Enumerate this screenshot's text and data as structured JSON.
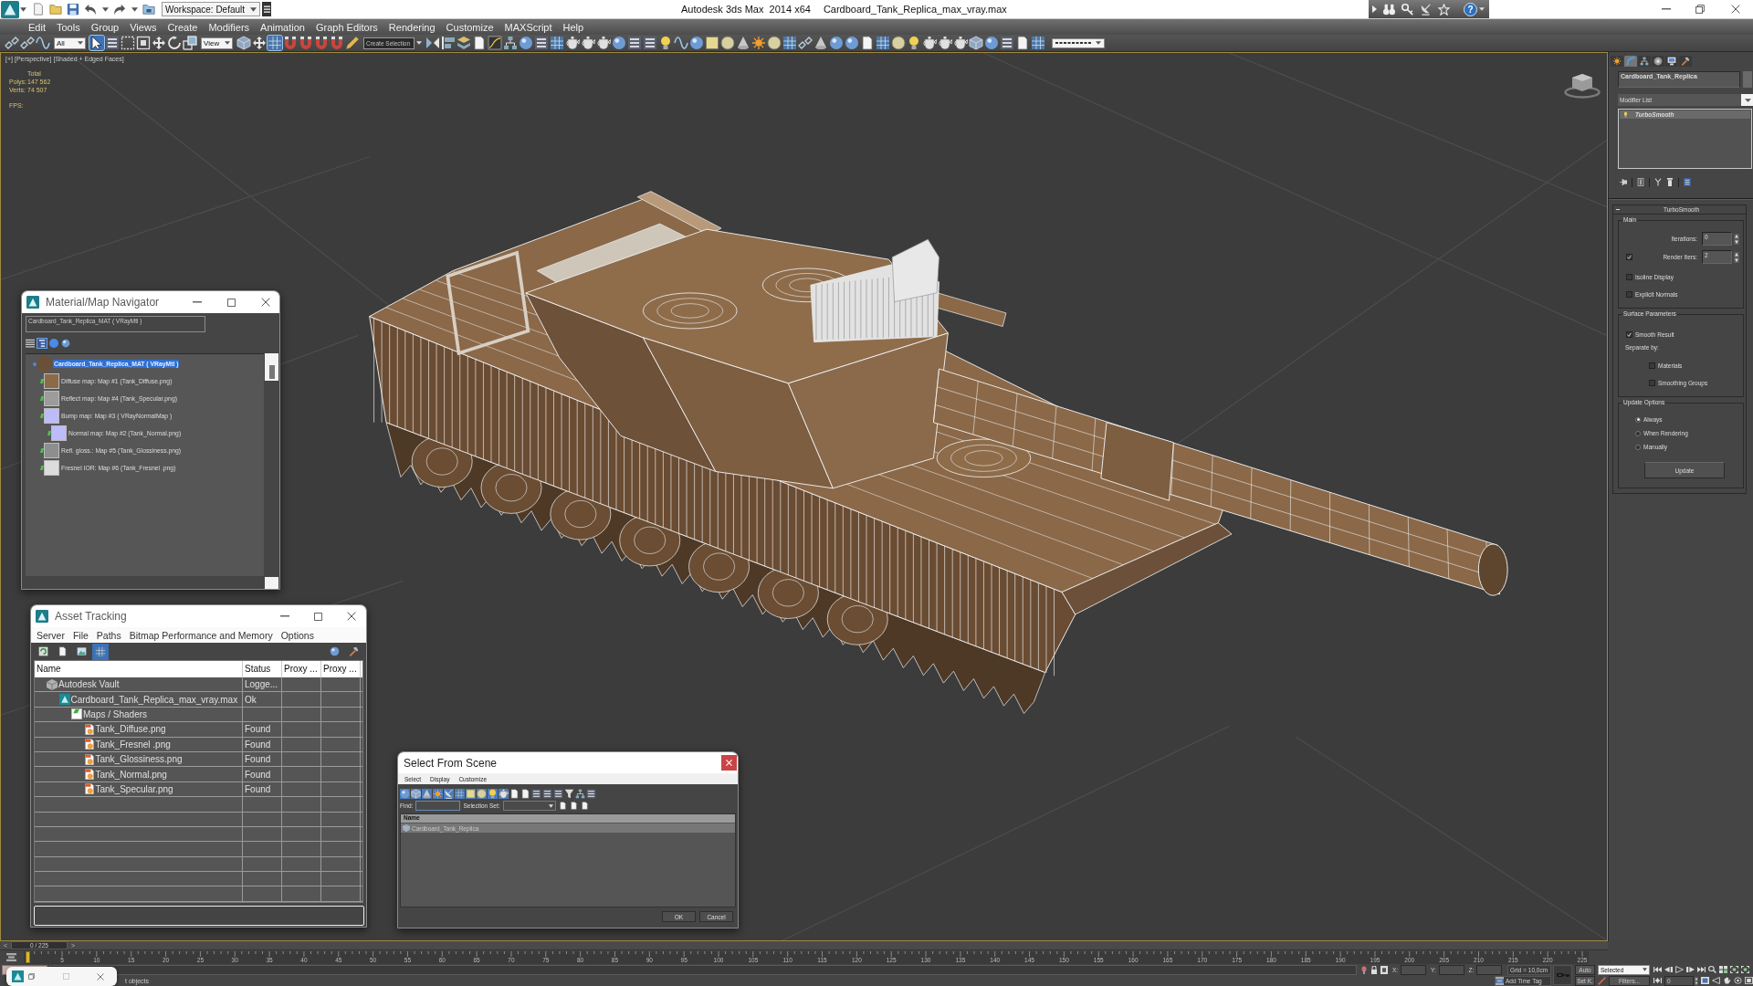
{
  "title_bar": {
    "workspace": "Workspace: Default",
    "app_name": "Autodesk 3ds Max  2014 x64",
    "document": "Cardboard_Tank_Replica_max_vray.max",
    "help": "?"
  },
  "menu_bar": [
    "Edit",
    "Tools",
    "Group",
    "Views",
    "Create",
    "Modifiers",
    "Animation",
    "Graph Editors",
    "Rendering",
    "Customize",
    "MAXScript",
    "Help"
  ],
  "main_toolbar": [
    {
      "kind": "button",
      "selected": false
    },
    {
      "kind": "button",
      "selected": false
    },
    {
      "kind": "button",
      "selected": false
    },
    {
      "kind": "dropdown",
      "value": "All"
    },
    {
      "kind": "button",
      "selected": true
    },
    {
      "kind": "button",
      "selected": false
    },
    {
      "kind": "button",
      "selected": false
    },
    {
      "kind": "button",
      "selected": false
    },
    {
      "kind": "button",
      "selected": false
    },
    {
      "kind": "button",
      "selected": false
    },
    {
      "kind": "button",
      "selected": false
    },
    {
      "kind": "dropdown",
      "value": "View"
    },
    {
      "kind": "button",
      "selected": false
    },
    {
      "kind": "button",
      "selected": false
    },
    {
      "kind": "button",
      "selected": true
    },
    {
      "kind": "button",
      "selected": false
    },
    {
      "kind": "button",
      "selected": false
    },
    {
      "kind": "button",
      "selected": false
    },
    {
      "kind": "button",
      "selected": false
    },
    {
      "kind": "button",
      "selected": false
    },
    {
      "kind": "combo",
      "placeholder": "Create Selection"
    },
    {
      "kind": "button",
      "selected": false
    },
    {
      "kind": "button",
      "selected": false
    },
    {
      "kind": "button",
      "selected": false
    },
    {
      "kind": "button",
      "selected": false
    },
    {
      "kind": "button",
      "selected": false
    },
    {
      "kind": "button",
      "selected": false
    },
    {
      "kind": "button",
      "selected": false
    },
    {
      "kind": "button",
      "selected": false
    },
    {
      "kind": "button",
      "selected": false
    },
    {
      "kind": "button",
      "selected": false
    },
    {
      "kind": "button",
      "selected": false
    },
    {
      "kind": "button",
      "selected": false
    },
    {
      "kind": "button",
      "selected": false
    },
    {
      "kind": "button",
      "selected": false
    },
    {
      "kind": "button",
      "selected": false
    },
    {
      "kind": "button",
      "selected": false
    },
    {
      "kind": "button",
      "selected": false
    },
    {
      "kind": "button",
      "selected": false
    },
    {
      "kind": "button",
      "selected": false
    },
    {
      "kind": "button",
      "selected": false
    },
    {
      "kind": "button",
      "selected": false
    },
    {
      "kind": "button",
      "selected": false
    },
    {
      "kind": "button",
      "selected": false
    },
    {
      "kind": "button",
      "selected": false
    },
    {
      "kind": "button",
      "selected": false
    },
    {
      "kind": "button",
      "selected": false
    },
    {
      "kind": "button",
      "selected": false
    },
    {
      "kind": "button",
      "selected": false
    },
    {
      "kind": "button",
      "selected": false
    },
    {
      "kind": "button",
      "selected": false
    },
    {
      "kind": "button",
      "selected": false
    },
    {
      "kind": "button",
      "selected": false
    },
    {
      "kind": "button",
      "selected": false
    },
    {
      "kind": "button",
      "selected": false
    },
    {
      "kind": "button",
      "selected": false
    },
    {
      "kind": "button",
      "selected": false
    },
    {
      "kind": "button",
      "selected": false
    },
    {
      "kind": "button",
      "selected": false
    },
    {
      "kind": "button",
      "selected": false
    },
    {
      "kind": "button",
      "selected": false
    },
    {
      "kind": "line_dropdown"
    }
  ],
  "viewport": {
    "labels": [
      "[+]",
      "[Perspective]",
      "[Shaded + Edged Faces]"
    ],
    "stats_title": "Total",
    "stats": [
      {
        "label": "Polys:",
        "value": "147 562"
      },
      {
        "label": "Verts:",
        "value": "74 507"
      }
    ],
    "fps_label": "FPS:"
  },
  "material_navigator": {
    "title": "Material/Map Navigator",
    "material_field": "Cardboard_Tank_Replica_MAT  ( VRayMtl )",
    "view_buttons": [
      {
        "selected": false
      },
      {
        "selected": true
      },
      {
        "selected": false
      },
      {
        "selected": false
      }
    ],
    "tree": [
      {
        "kind": "material",
        "label": "Cardboard_Tank_Replica_MAT  ( VRayMtl )",
        "color": "#6b5038",
        "selected": true,
        "children": [
          {
            "kind": "map",
            "label": "Diffuse map: Map #1 (Tank_Diffuse.png)",
            "color": "#8c6a48",
            "selected": false
          },
          {
            "kind": "map",
            "label": "Reflect map: Map #4 (Tank_Specular.png)",
            "color": "#9c9c9c",
            "selected": false
          },
          {
            "kind": "map",
            "label": "Bump map: Map #3  ( VRayNormalMap )",
            "color": "#bcbcfa",
            "selected": false,
            "children": [
              {
                "kind": "map",
                "label": "Normal map: Map #2 (Tank_Normal.png)",
                "color": "#bcbcfa",
                "selected": false
              }
            ]
          },
          {
            "kind": "map",
            "label": "Refl. gloss.: Map #5 (Tank_Glossiness.png)",
            "color": "#8e8e8e",
            "selected": false
          },
          {
            "kind": "map",
            "label": "Fresnel IOR: Map #6 (Tank_Fresnel .png)",
            "color": "#dcdcdc",
            "selected": false
          }
        ]
      }
    ]
  },
  "asset_tracking": {
    "title": "Asset Tracking",
    "menu": [
      "Server",
      "File",
      "Paths",
      "Bitmap Performance and Memory",
      "Options"
    ],
    "toolbar": [
      {
        "selected": false
      },
      {
        "selected": false
      },
      {
        "selected": false
      },
      {
        "selected": true
      },
      {
        "selected": false
      },
      {
        "selected": false
      }
    ],
    "columns": [
      "Name",
      "Status",
      "Proxy ...",
      "Proxy ..."
    ],
    "rows": [
      {
        "kind": "vault",
        "name": "Autodesk Vault",
        "status": "Logge...",
        "children": [
          {
            "kind": "scene",
            "name": "Cardboard_Tank_Replica_max_vray.max",
            "status": "Ok",
            "children": [
              {
                "kind": "folder",
                "name": "Maps / Shaders",
                "children": [
                  {
                    "kind": "bitmap",
                    "name": "Tank_Diffuse.png",
                    "status": "Found"
                  },
                  {
                    "kind": "bitmap",
                    "name": "Tank_Fresnel .png",
                    "status": "Found"
                  },
                  {
                    "kind": "bitmap",
                    "name": "Tank_Glossiness.png",
                    "status": "Found"
                  },
                  {
                    "kind": "bitmap",
                    "name": "Tank_Normal.png",
                    "status": "Found"
                  },
                  {
                    "kind": "bitmap",
                    "name": "Tank_Specular.png",
                    "status": "Found"
                  }
                ]
              }
            ]
          }
        ]
      }
    ]
  },
  "select_from_scene": {
    "title": "Select From Scene",
    "menu": [
      "Select",
      "Display",
      "Customize"
    ],
    "toolbar": [
      {
        "selected": true
      },
      {
        "selected": true
      },
      {
        "selected": true
      },
      {
        "selected": true
      },
      {
        "selected": true
      },
      {
        "selected": true
      },
      {
        "selected": true
      },
      {
        "selected": true
      },
      {
        "selected": true
      },
      {
        "selected": true
      },
      {
        "selected": false
      },
      {
        "selected": false
      },
      {
        "selected": false
      },
      {
        "selected": false
      },
      {
        "selected": false
      },
      {
        "selected": false
      },
      {
        "selected": false
      },
      {
        "selected": false
      }
    ],
    "find_label": "Find:",
    "selection_set_label": "Selection Set:",
    "column": "Name",
    "items": [
      {
        "name": "Cardboard_Tank_Replica",
        "selected": true
      }
    ],
    "buttons": [
      "OK",
      "Cancel"
    ]
  },
  "command_panel": {
    "tabs": [
      {
        "kind": "create",
        "selected": false
      },
      {
        "kind": "modify",
        "selected": true
      },
      {
        "kind": "hierarchy",
        "selected": false
      },
      {
        "kind": "motion",
        "selected": false
      },
      {
        "kind": "display",
        "selected": false
      },
      {
        "kind": "utilities",
        "selected": false
      }
    ],
    "object_name": "Cardboard_Tank_Replica",
    "modifier_list": "Modifier List",
    "stack": [
      {
        "name": "TurboSmooth",
        "selected": true
      }
    ],
    "rollout": {
      "title": "TurboSmooth",
      "groups": [
        {
          "title": "Main",
          "controls": [
            {
              "kind": "spinner",
              "label": "Iterations:",
              "value": "0"
            },
            {
              "kind": "checked_spinner",
              "label": "Render Iters:",
              "value": "2",
              "checked": true
            },
            {
              "kind": "checkbox",
              "label": "Isoline Display",
              "checked": false
            },
            {
              "kind": "checkbox",
              "label": "Explicit Normals",
              "checked": false
            }
          ]
        },
        {
          "title": "Surface Parameters",
          "controls": [
            {
              "kind": "checkbox",
              "label": "Smooth Result",
              "checked": true
            },
            {
              "kind": "label",
              "label": "Separate by:",
              "children": [
                {
                  "kind": "checkbox",
                  "label": "Materials",
                  "checked": false
                },
                {
                  "kind": "checkbox",
                  "label": "Smoothing Groups",
                  "checked": false
                }
              ]
            }
          ]
        },
        {
          "title": "Update Options",
          "controls": [
            {
              "kind": "radio",
              "label": "Always",
              "selected": true
            },
            {
              "kind": "radio",
              "label": "When Rendering",
              "selected": false
            },
            {
              "kind": "radio",
              "label": "Manually",
              "selected": false
            },
            {
              "kind": "button",
              "label": "Update"
            }
          ]
        }
      ]
    }
  },
  "timeline": {
    "prev": "<",
    "frame": "0 / 225",
    "next": ">",
    "level": 0,
    "ticks": [
      "5",
      "10",
      "15",
      "20",
      "25",
      "30",
      "35",
      "40",
      "45",
      "50",
      "55",
      "60",
      "65",
      "70",
      "75",
      "80",
      "85",
      "90",
      "95",
      "100",
      "105",
      "110",
      "115",
      "120",
      "125",
      "130",
      "135",
      "140",
      "145",
      "150",
      "155",
      "160",
      "165",
      "170",
      "175",
      "180",
      "185",
      "190",
      "195",
      "200",
      "205",
      "210",
      "215",
      "220",
      "225"
    ]
  },
  "status_bar": {
    "prompt": "t objects",
    "coords": [
      {
        "label": "X:"
      },
      {
        "label": "Y:"
      },
      {
        "label": "Z:"
      }
    ],
    "grid": "Grid = 10,0cm",
    "time_tag": "Add Time Tag",
    "auto_key": "Auto",
    "set_key": "Set K.",
    "key_filter": "Selected",
    "filters": "Filters...",
    "frame": "0"
  }
}
